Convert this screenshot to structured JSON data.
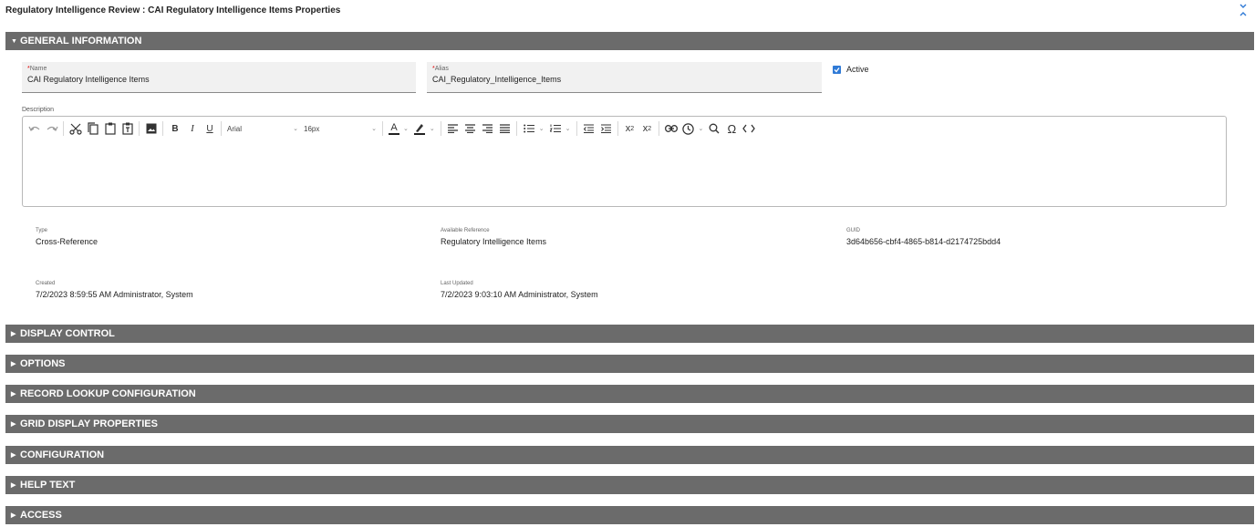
{
  "page": {
    "title": "Regulatory Intelligence Review : CAI Regulatory Intelligence Items Properties"
  },
  "sections": {
    "general": "GENERAL INFORMATION",
    "display_control": "DISPLAY CONTROL",
    "options": "OPTIONS",
    "record_lookup": "RECORD LOOKUP CONFIGURATION",
    "grid_display": "GRID DISPLAY PROPERTIES",
    "configuration": "CONFIGURATION",
    "help_text": "HELP TEXT",
    "access": "ACCESS"
  },
  "general": {
    "name": {
      "required_mark": "*",
      "label": "Name",
      "value": "CAI Regulatory Intelligence Items"
    },
    "alias": {
      "required_mark": "*",
      "label": "Alias",
      "value": "CAI_Regulatory_Intelligence_Items"
    },
    "active": {
      "label": "Active",
      "checked": true
    },
    "description": {
      "label": "Description",
      "font_family": "Arial",
      "font_size": "16px",
      "text_color_letter": "A"
    },
    "type": {
      "label": "Type",
      "value": "Cross-Reference"
    },
    "available_reference": {
      "label": "Available Reference",
      "value": "Regulatory Intelligence Items"
    },
    "guid": {
      "label": "GUID",
      "value": "3d64b656-cbf4-4865-b814-d2174725bdd4"
    },
    "created": {
      "label": "Created",
      "value": "7/2/2023  8:59:55 AM Administrator, System"
    },
    "last_updated": {
      "label": "Last Updated",
      "value": "7/2/2023  9:03:10 AM Administrator, System"
    }
  },
  "colors": {
    "section_bar": "#6b6b6b",
    "accent": "#2f7ad6",
    "field_bg": "#f1f1f1"
  }
}
